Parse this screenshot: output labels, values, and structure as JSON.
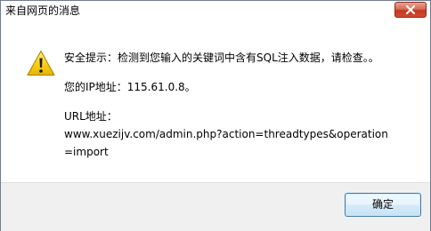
{
  "window": {
    "title": "来自网页的消息"
  },
  "message": {
    "icon": "warning-icon",
    "line1": "安全提示：检测到您输入的关键词中含有SQL注入数据，请检查。。",
    "line2": "您的IP地址：115.61.0.8。",
    "line3": "URL地址：",
    "url": "www.xuezijv.com/admin.php?action=threadtypes&operation=import"
  },
  "buttons": {
    "ok_label": "确定",
    "close_icon": "close-icon"
  },
  "colors": {
    "close_button": "#c3391f",
    "warning_yellow": "#f5c400",
    "ok_button_border": "#3c7fb1"
  }
}
